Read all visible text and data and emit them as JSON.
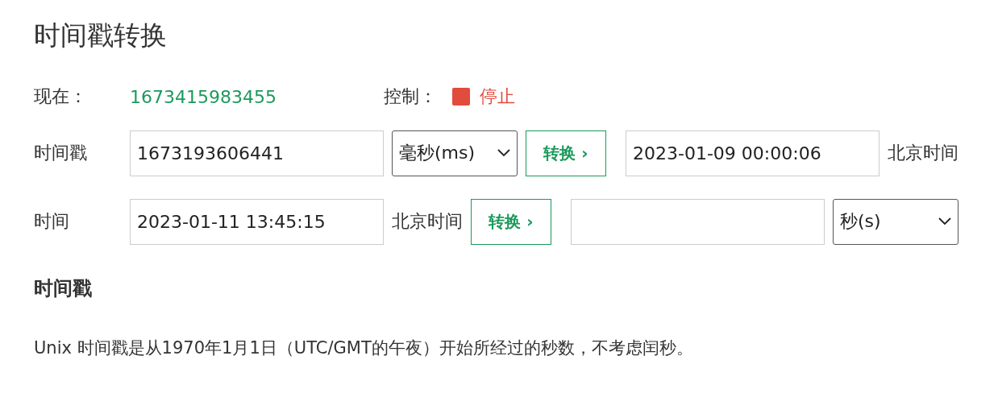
{
  "title": "时间戳转换",
  "now": {
    "label": "现在：",
    "value": "1673415983455"
  },
  "control": {
    "label": "控制：",
    "button": "停止"
  },
  "rows": [
    {
      "label": "时间戳",
      "items": [
        {
          "kind": "input",
          "value": "1673193606441"
        },
        {
          "kind": "select",
          "value": "毫秒(ms)"
        },
        {
          "kind": "button",
          "text": "转换 ›"
        },
        {
          "kind": "input",
          "value": "2023-01-09 00:00:06"
        },
        {
          "kind": "text",
          "text": "北京时间"
        }
      ]
    },
    {
      "label": "时间",
      "items": [
        {
          "kind": "input",
          "value": "2023-01-11 13:45:15"
        },
        {
          "kind": "text",
          "text": "北京时间"
        },
        {
          "kind": "button",
          "text": "转换 ›"
        },
        {
          "kind": "input",
          "value": ""
        },
        {
          "kind": "select",
          "value": "秒(s)"
        }
      ]
    }
  ],
  "section": {
    "heading": "时间戳",
    "text": "Unix 时间戳是从1970年1月1日（UTC/GMT的午夜）开始所经过的秒数，不考虑闰秒。"
  }
}
